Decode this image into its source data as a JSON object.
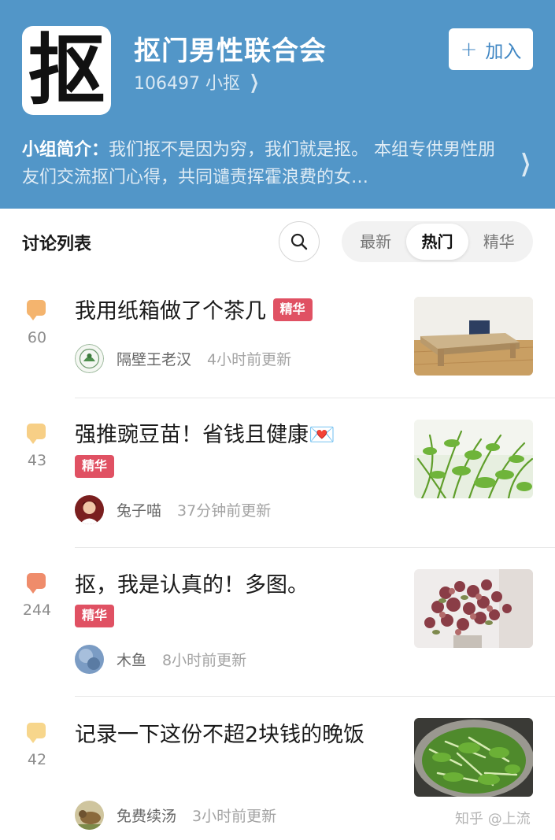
{
  "group": {
    "avatar_char": "抠",
    "name": "抠门男性联合会",
    "members": "106497 小抠",
    "join_label": "加入",
    "intro_label": "小组简介：",
    "intro_text": "我们抠不是因为穷，我们就是抠。 本组专供男性朋友们交流抠门心得，共同谴责挥霍浪费的女…"
  },
  "discussion": {
    "title": "讨论列表",
    "tabs": [
      "最新",
      "热门",
      "精华"
    ],
    "active_tab": "热门"
  },
  "posts": [
    {
      "count": "60",
      "bubble_color": "#f4b46e",
      "title": "我用纸箱做了个茶几",
      "badge": "精华",
      "author": "隔壁王老汉",
      "updated": "4小时前更新"
    },
    {
      "count": "43",
      "bubble_color": "#f7cf86",
      "title": "强推豌豆苗！省钱且健康💌",
      "badge": "精华",
      "author": "兔子喵",
      "updated": "37分钟前更新"
    },
    {
      "count": "244",
      "bubble_color": "#ef8c6b",
      "title": "抠，我是认真的！多图。",
      "badge": "精华",
      "author": "木鱼",
      "updated": "8小时前更新"
    },
    {
      "count": "42",
      "bubble_color": "#f7d68c",
      "title": "记录一下这份不超2块钱的晚饭",
      "badge": "",
      "author": "免费续汤",
      "updated": "3小时前更新"
    }
  ],
  "watermark": "知乎 @上流",
  "colors": {
    "header_bg": "#5296c8",
    "badge": "#e05163",
    "join_text": "#3f86c3"
  }
}
